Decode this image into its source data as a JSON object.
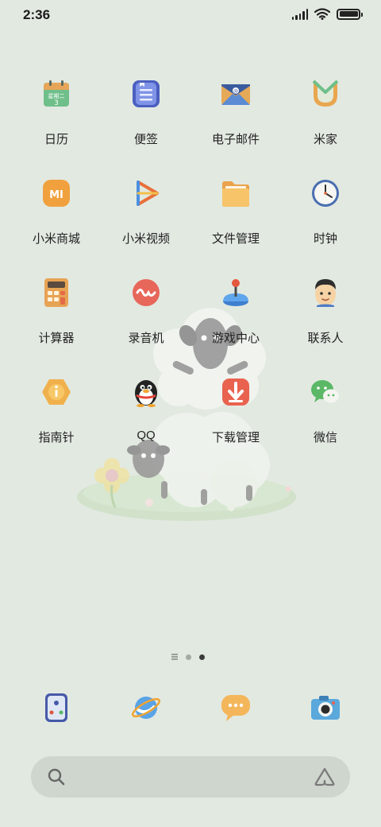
{
  "status_bar": {
    "time": "2:36"
  },
  "apps": [
    {
      "label": "日历",
      "icon": "calendar-icon",
      "calendar_top": "星期二",
      "calendar_day": "3"
    },
    {
      "label": "便签",
      "icon": "notes-icon"
    },
    {
      "label": "电子邮件",
      "icon": "email-icon"
    },
    {
      "label": "米家",
      "icon": "mijia-icon"
    },
    {
      "label": "小米商城",
      "icon": "mi-store-icon",
      "icon_text": "MI"
    },
    {
      "label": "小米视频",
      "icon": "mi-video-icon"
    },
    {
      "label": "文件管理",
      "icon": "folder-icon"
    },
    {
      "label": "时钟",
      "icon": "clock-icon"
    },
    {
      "label": "计算器",
      "icon": "calculator-icon"
    },
    {
      "label": "录音机",
      "icon": "recorder-icon"
    },
    {
      "label": "游戏中心",
      "icon": "game-center-icon"
    },
    {
      "label": "联系人",
      "icon": "contacts-icon"
    },
    {
      "label": "指南针",
      "icon": "compass-icon"
    },
    {
      "label": "QQ",
      "icon": "qq-penguin-icon"
    },
    {
      "label": "下载管理",
      "icon": "download-icon"
    },
    {
      "label": "微信",
      "icon": "wechat-icon"
    }
  ],
  "dock": [
    {
      "icon": "phone-icon"
    },
    {
      "icon": "browser-icon"
    },
    {
      "icon": "messages-icon"
    },
    {
      "icon": "camera-icon"
    }
  ],
  "pages": {
    "count": 2,
    "active": 2
  },
  "search": {
    "value": ""
  },
  "colors": {
    "background": "#e2e9e1",
    "search_bar": "#cfd6ce",
    "active_dot": "#3a3a3a"
  }
}
